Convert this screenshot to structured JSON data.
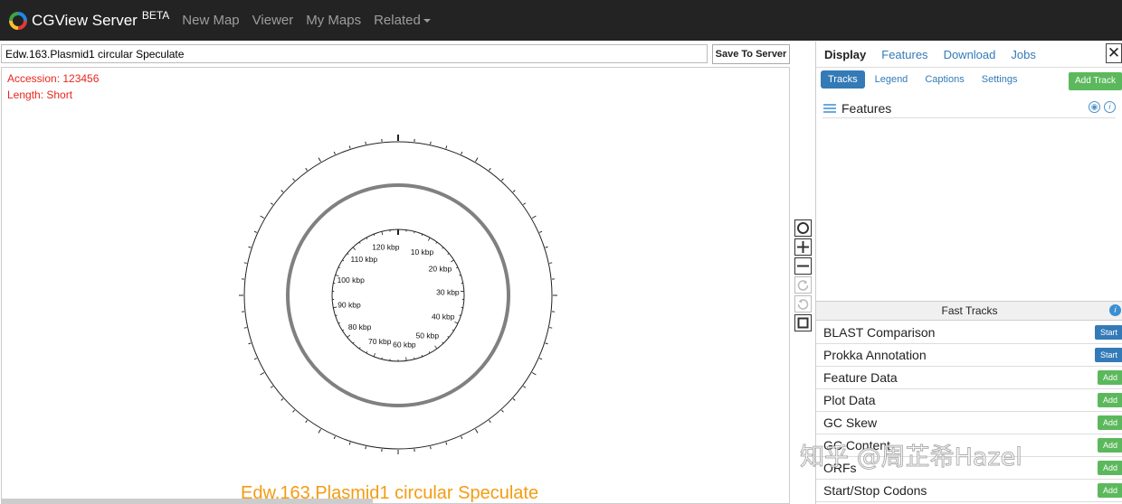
{
  "navbar": {
    "brand": "CGView Server",
    "beta": "BETA",
    "links": [
      "New Map",
      "Viewer",
      "My Maps",
      "Related"
    ]
  },
  "map": {
    "title_value": "Edw.163.Plasmid1 circular Speculate",
    "save_label": "Save To Server",
    "accession": "Accession: 123456",
    "length": "Length: Short",
    "caption": "Edw.163.Plasmid1 circular Speculate",
    "tick_labels": [
      "10 kbp",
      "20 kbp",
      "30 kbp",
      "40 kbp",
      "50 kbp",
      "60 kbp",
      "70 kbp",
      "80 kbp",
      "90 kbp",
      "100 kbp",
      "110 kbp",
      "120 kbp"
    ],
    "controls": [
      "reset-view",
      "zoom-in",
      "zoom-out",
      "rotate-clockwise",
      "rotate-counterclockwise",
      "fullscreen"
    ]
  },
  "panel": {
    "tabs": [
      "Display",
      "Features",
      "Download",
      "Jobs"
    ],
    "close": "✕",
    "subtabs": [
      "Tracks",
      "Legend",
      "Captions",
      "Settings"
    ],
    "add_track": "Add Track",
    "track": "Features",
    "fast_header": "Fast Tracks",
    "fast_tracks": [
      {
        "name": "BLAST Comparison",
        "button": "Start"
      },
      {
        "name": "Prokka Annotation",
        "button": "Start"
      },
      {
        "name": "Feature Data",
        "button": "Add"
      },
      {
        "name": "Plot Data",
        "button": "Add"
      },
      {
        "name": "GC Skew",
        "button": "Add"
      },
      {
        "name": "GC Content",
        "button": "Add"
      },
      {
        "name": "ORFs",
        "button": "Add"
      },
      {
        "name": "Start/Stop Codons",
        "button": "Add"
      }
    ]
  },
  "watermark": "知乎 @周芷希Hazel",
  "colors": {
    "navbar": "#232323",
    "meta_text": "#e8261d",
    "caption": "#f39c12",
    "link": "#337ab7",
    "add_button": "#5cb85c",
    "backbone": "#808080"
  }
}
